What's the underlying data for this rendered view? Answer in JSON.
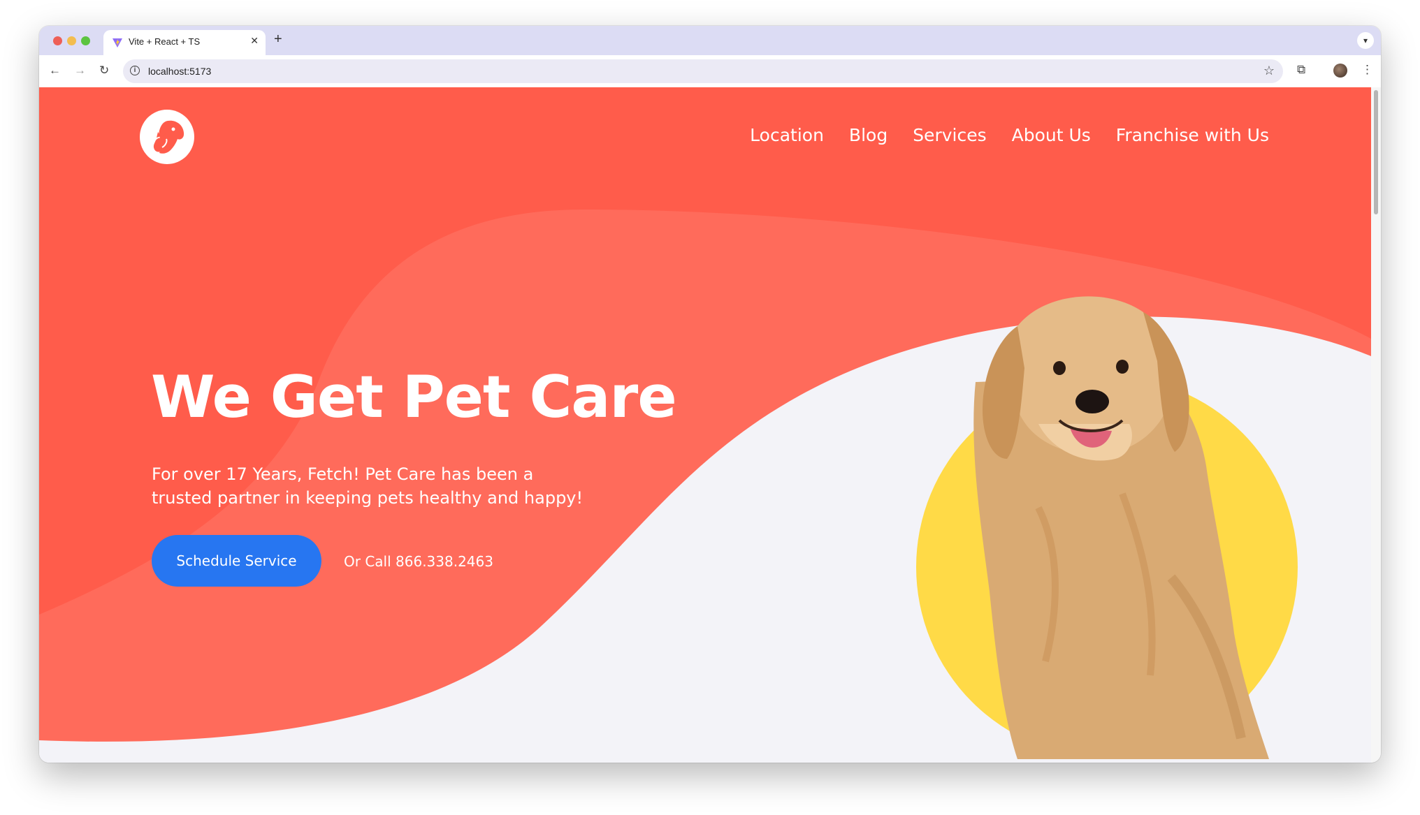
{
  "browser": {
    "tab_title": "Vite + React + TS",
    "tab_close": "✕",
    "new_tab": "+",
    "url": "localhost:5173",
    "tab_menu_icon": "chevron-down-icon",
    "back_icon": "arrow-left-icon",
    "forward_icon": "arrow-right-icon",
    "reload_icon": "reload-icon",
    "bookmark_icon": "star-icon",
    "extensions_icon": "puzzle-icon",
    "menu_icon": "kebab-menu-icon"
  },
  "site": {
    "logo_icon": "dog-and-cat-logo-icon",
    "nav": [
      {
        "label": "Location"
      },
      {
        "label": "Blog"
      },
      {
        "label": "Services"
      },
      {
        "label": "About Us"
      },
      {
        "label": "Franchise with Us"
      }
    ]
  },
  "hero": {
    "title": "We Get Pet Care",
    "subtitle": "For over 17 Years, Fetch! Pet Care has been a trusted partner in keeping pets healthy and happy!",
    "cta_label": "Schedule Service",
    "call_text": "Or Call 866.338.2463",
    "image": "golden-retriever-photo"
  },
  "colors": {
    "brand_coral": "#ff5c4b",
    "coral_light": "#ff6b5b",
    "accent_yellow": "#ffda47",
    "button_blue": "#2776f1",
    "page_bg": "#f3f3f8"
  }
}
